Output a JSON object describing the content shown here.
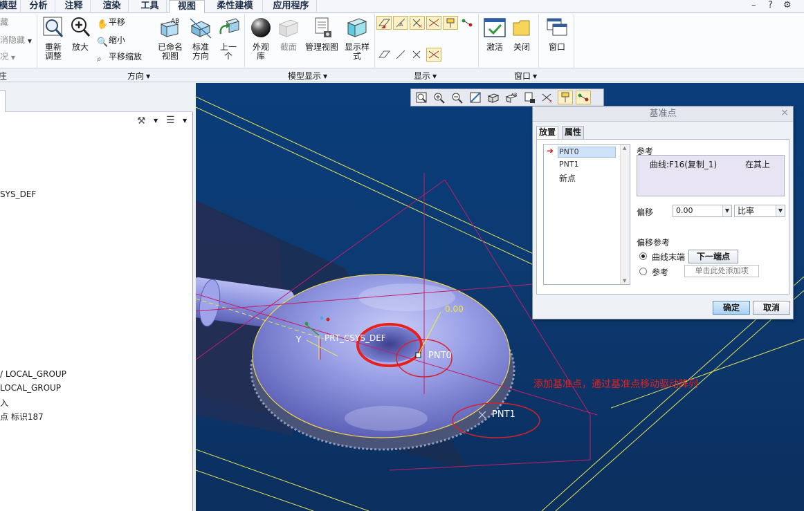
{
  "tabs": [
    "模型",
    "分析",
    "注释",
    "渲染",
    "工具",
    "视图",
    "柔性建模",
    "应用程序"
  ],
  "active_tab": "视图",
  "window_controls": [
    "–",
    "?",
    "⚙"
  ],
  "ribbon": {
    "left_partial": {
      "item1": "藏",
      "item2": "消隐藏",
      "item3": "况"
    },
    "refit": "重新\n调整",
    "zoom_in": "放大",
    "pan": "平移",
    "zoom_out": "缩小",
    "pan_zoom": "平移缩放",
    "named_view": "已命名\n视图",
    "standard_orient": "标准\n方向",
    "previous": "上一\n个",
    "appearance": "外观\n库",
    "section": "截面",
    "manage_views": "管理视图",
    "display_style": "显示样\n式",
    "activate": "激活",
    "close": "关闭",
    "window": "窗口"
  },
  "groups": {
    "partial": "庄",
    "orientation": "方向",
    "model_display": "模型显示",
    "show": "显示",
    "window": "窗口"
  },
  "tree": {
    "item_csys": "SYS_DEF",
    "item_group1": "/ LOCAL_GROUP",
    "item_group2": "LOCAL_GROUP",
    "item_insert": "入",
    "item_point": "点 标识187"
  },
  "viewport": {
    "csys_label": "PRT_CSYS_DEF",
    "csys_axis_y": "Y",
    "pnt0": "PNT0",
    "pnt1": "PNT1",
    "offset_value": "0.00",
    "annotation": "添加基准点，通过基准点移动驱动阵列"
  },
  "dialog": {
    "title": "基准点",
    "tab_placement": "放置",
    "tab_properties": "属性",
    "points": [
      "PNT0",
      "PNT1",
      "新点"
    ],
    "reference_label": "参考",
    "reference_item": "曲线:F16(复制_1)",
    "reference_constraint": "在其上",
    "offset_label": "偏移",
    "offset_value": "0.00",
    "offset_type": "比率",
    "offset_ref_label": "偏移参考",
    "opt_curve_end": "曲线末端",
    "next_end_btn": "下一端点",
    "opt_reference": "参考",
    "add_item_placeholder": "单击此处添加项",
    "ok": "确定",
    "cancel": "取消"
  },
  "colors": {
    "viewport_bg": "#0b3a72",
    "annotation_red": "#e8201c",
    "model_fill": "#9aa0e6",
    "datum_yellow": "#e8e84a"
  }
}
